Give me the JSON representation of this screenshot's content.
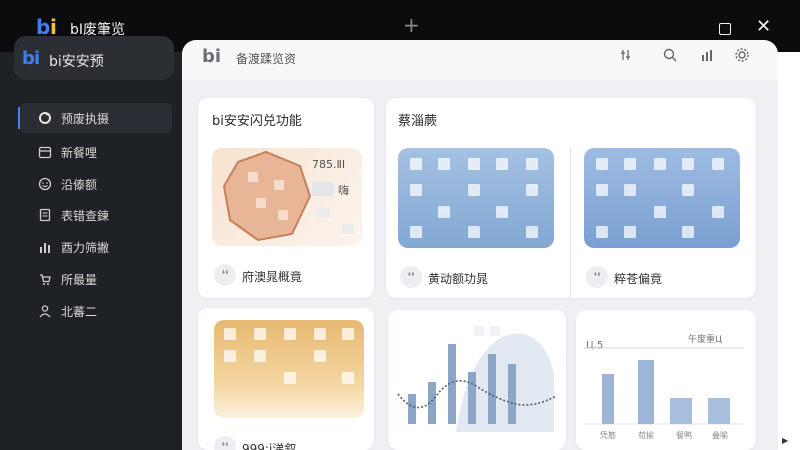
{
  "window": {
    "title": "bI废筆览",
    "new_tab": "+",
    "maximize": "□",
    "close": "✕"
  },
  "sidebar": {
    "brand": "bi安安预",
    "items": [
      {
        "label": "预废执摄",
        "icon": "refresh-icon",
        "active": true
      },
      {
        "label": "新餐哩",
        "icon": "calendar-icon"
      },
      {
        "label": "沿傣额",
        "icon": "emoji-icon"
      },
      {
        "label": "表错查鍊",
        "icon": "document-icon"
      },
      {
        "label": "酉力筛撇",
        "icon": "bar-chart-icon"
      },
      {
        "label": "所最量",
        "icon": "cart-icon"
      },
      {
        "label": "北蕃二",
        "icon": "user-icon"
      }
    ]
  },
  "header": {
    "title": "备渡蹂览资"
  },
  "panel_left": {
    "title": "bi安安闪兑功能",
    "tile1": {
      "value": "785.ⅡI",
      "text": "嗨"
    },
    "tile1_caption": "府澳晁概竟",
    "tile2_caption": "999:i涕叙"
  },
  "panel_right": {
    "title": "蔡淄蕨",
    "tile_a_caption": "黄动额功晁",
    "tile_b_caption": "粹苍偏竟",
    "bar_card": {
      "corner_label": "午废重Ц",
      "value_label": "Ц.5",
      "categories": [
        "凭筋",
        "苟揄",
        "餐鸭",
        "叠喻"
      ]
    }
  },
  "colors": {
    "accent": "#4a80f0",
    "sidebar_bg": "#1e2125",
    "titlebar_bg": "#0c0c0e",
    "tile_blue": "#8fb2da",
    "tile_peach": "#f1d2b6",
    "tile_gold": "#e8c27e"
  }
}
